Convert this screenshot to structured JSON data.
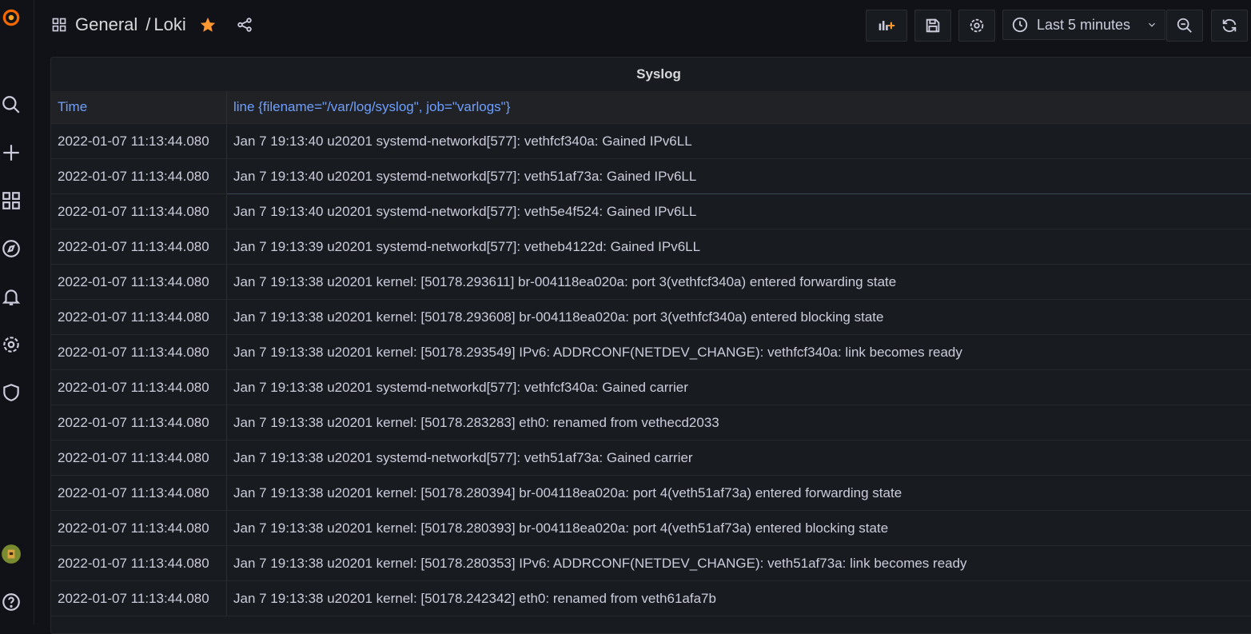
{
  "breadcrumb": {
    "folder": "General",
    "separator": "/",
    "dashboard": "Loki"
  },
  "toolbar": {
    "time_range": "Last 5 minutes"
  },
  "panel": {
    "title": "Syslog",
    "columns": [
      "Time",
      "line {filename=\"/var/log/syslog\", job=\"varlogs\"}"
    ],
    "rows": [
      {
        "time": "2022-01-07 11:13:44.080",
        "line": "Jan 7 19:13:40 u20201 systemd-networkd[577]: vethfcf340a: Gained IPv6LL"
      },
      {
        "time": "2022-01-07 11:13:44.080",
        "line": "Jan 7 19:13:40 u20201 systemd-networkd[577]: veth51af73a: Gained IPv6LL"
      },
      {
        "time": "2022-01-07 11:13:44.080",
        "line": "Jan 7 19:13:40 u20201 systemd-networkd[577]: veth5e4f524: Gained IPv6LL"
      },
      {
        "time": "2022-01-07 11:13:44.080",
        "line": "Jan 7 19:13:39 u20201 systemd-networkd[577]: vetheb4122d: Gained IPv6LL"
      },
      {
        "time": "2022-01-07 11:13:44.080",
        "line": "Jan 7 19:13:38 u20201 kernel: [50178.293611] br-004118ea020a: port 3(vethfcf340a) entered forwarding state"
      },
      {
        "time": "2022-01-07 11:13:44.080",
        "line": "Jan 7 19:13:38 u20201 kernel: [50178.293608] br-004118ea020a: port 3(vethfcf340a) entered blocking state"
      },
      {
        "time": "2022-01-07 11:13:44.080",
        "line": "Jan 7 19:13:38 u20201 kernel: [50178.293549] IPv6: ADDRCONF(NETDEV_CHANGE): vethfcf340a: link becomes ready"
      },
      {
        "time": "2022-01-07 11:13:44.080",
        "line": "Jan 7 19:13:38 u20201 systemd-networkd[577]: vethfcf340a: Gained carrier"
      },
      {
        "time": "2022-01-07 11:13:44.080",
        "line": "Jan 7 19:13:38 u20201 kernel: [50178.283283] eth0: renamed from vethecd2033"
      },
      {
        "time": "2022-01-07 11:13:44.080",
        "line": "Jan 7 19:13:38 u20201 systemd-networkd[577]: veth51af73a: Gained carrier"
      },
      {
        "time": "2022-01-07 11:13:44.080",
        "line": "Jan 7 19:13:38 u20201 kernel: [50178.280394] br-004118ea020a: port 4(veth51af73a) entered forwarding state"
      },
      {
        "time": "2022-01-07 11:13:44.080",
        "line": "Jan 7 19:13:38 u20201 kernel: [50178.280393] br-004118ea020a: port 4(veth51af73a) entered blocking state"
      },
      {
        "time": "2022-01-07 11:13:44.080",
        "line": "Jan 7 19:13:38 u20201 kernel: [50178.280353] IPv6: ADDRCONF(NETDEV_CHANGE): veth51af73a: link becomes ready"
      },
      {
        "time": "2022-01-07 11:13:44.080",
        "line": "Jan 7 19:13:38 u20201 kernel: [50178.242342] eth0: renamed from veth61afa7b"
      }
    ]
  },
  "colors": {
    "accent_link": "#6e9fff",
    "star": "#ff9830",
    "logo": "#f46800"
  }
}
